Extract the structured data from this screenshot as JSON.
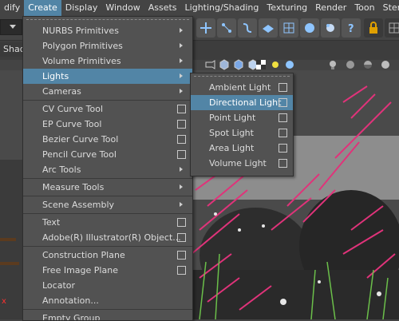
{
  "menubar": {
    "items": [
      "dify",
      "Create",
      "Display",
      "Window",
      "Assets",
      "Lighting/Shading",
      "Texturing",
      "Render",
      "Toon",
      "Stere"
    ],
    "active_index": 1
  },
  "shelf": {
    "tab_label": "Shad"
  },
  "create_menu": {
    "items": [
      {
        "label": "NURBS Primitives",
        "submenu": true
      },
      {
        "label": "Polygon Primitives",
        "submenu": true
      },
      {
        "label": "Volume Primitives",
        "submenu": true
      },
      {
        "label": "Lights",
        "submenu": true,
        "highlighted": true
      },
      {
        "label": "Cameras",
        "submenu": true
      },
      {
        "sep": true
      },
      {
        "label": "CV Curve Tool",
        "option": true
      },
      {
        "label": "EP Curve Tool",
        "option": true
      },
      {
        "label": "Bezier Curve Tool",
        "option": true
      },
      {
        "label": "Pencil Curve Tool",
        "option": true
      },
      {
        "label": "Arc Tools",
        "submenu": true
      },
      {
        "sep": true
      },
      {
        "label": "Measure Tools",
        "submenu": true
      },
      {
        "sep": true
      },
      {
        "label": "Scene Assembly",
        "submenu": true
      },
      {
        "sep": true
      },
      {
        "label": "Text",
        "option": true
      },
      {
        "label": "Adobe(R) Illustrator(R) Object...",
        "option": true
      },
      {
        "sep": true
      },
      {
        "label": "Construction Plane",
        "option": true
      },
      {
        "label": "Free Image Plane",
        "option": true
      },
      {
        "label": "Locator"
      },
      {
        "label": "Annotation..."
      },
      {
        "sep": true
      },
      {
        "label": "Empty Group"
      }
    ]
  },
  "lights_menu": {
    "items": [
      {
        "label": "Ambient Light",
        "option": true
      },
      {
        "label": "Directional Light",
        "option": true,
        "highlighted": true
      },
      {
        "label": "Point Light",
        "option": true
      },
      {
        "label": "Spot Light",
        "option": true
      },
      {
        "label": "Area Light",
        "option": true
      },
      {
        "label": "Volume Light",
        "option": true
      }
    ]
  },
  "colors": {
    "highlight": "#5285a6",
    "menu_bg": "#525252",
    "app_bg": "#444444",
    "flowers": "#e0337a"
  },
  "toolbar_icons": [
    "move-icon",
    "snap-curve-icon",
    "snap-point-icon",
    "plane-icon",
    "grid-icon",
    "render-icon",
    "help-icon",
    "lock-icon"
  ],
  "shelf_icons": [
    "camera-icon",
    "cube-icon",
    "cube-icon",
    "cube-icon",
    "checker-icon",
    "light-icon",
    "sphere-icon",
    "sphere-icon",
    "light-bulb-icon"
  ]
}
